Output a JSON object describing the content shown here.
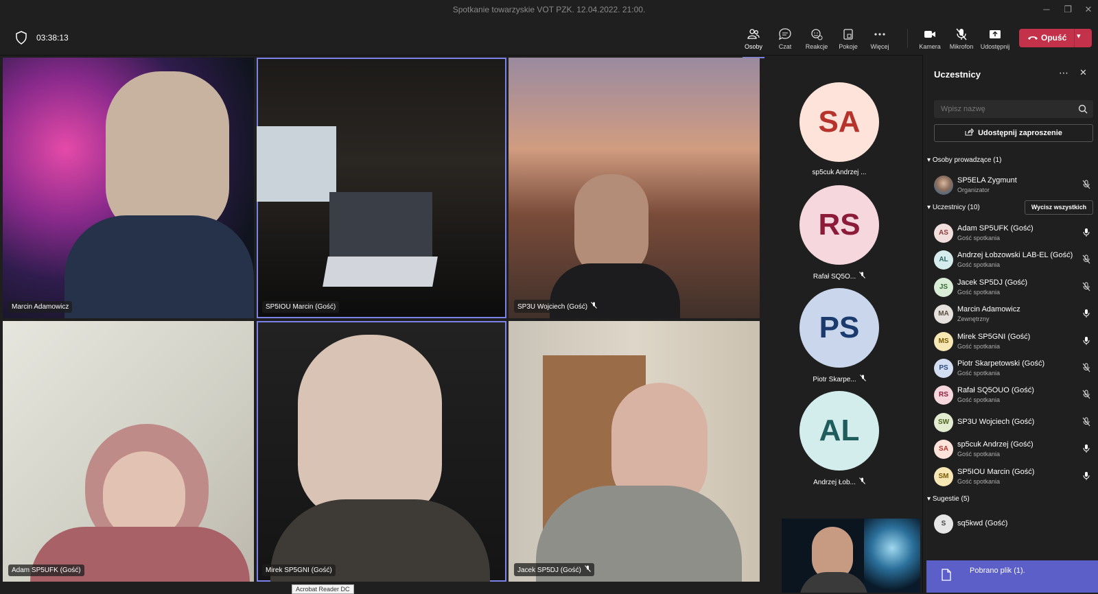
{
  "window": {
    "title": "Spotkanie towarzyskie VOT PZK. 12.04.2022. 21:00."
  },
  "toolbar": {
    "timer": "03:38:13",
    "people": "Osoby",
    "chat": "Czat",
    "reactions": "Reakcje",
    "rooms": "Pokoje",
    "more": "Więcej",
    "camera": "Kamera",
    "mic": "Mikrofon",
    "share": "Udostępnij",
    "leave": "Opuść"
  },
  "tiles": [
    {
      "name": "Marcin Adamowicz"
    },
    {
      "name": "SP5IOU Marcin (Gość)"
    },
    {
      "name": "SP3U Wojciech (Gość)"
    },
    {
      "name": "Adam SP5UFK (Gość)"
    },
    {
      "name": "Mirek SP5GNI (Gość)"
    },
    {
      "name": "Jacek SP5DJ (Gość)"
    }
  ],
  "avatars": [
    {
      "initials": "SA",
      "caption": "sp5cuk Andrzej ...",
      "bg": "#fde3d9",
      "fg": "#b5332a"
    },
    {
      "initials": "RS",
      "caption": "Rafał SQ5O...",
      "bg": "#f6d7dd",
      "fg": "#8c1b3a"
    },
    {
      "initials": "PS",
      "caption": "Piotr Skarpe...",
      "bg": "#c9d6ec",
      "fg": "#1b3b6f"
    },
    {
      "initials": "AL",
      "caption": "Andrzej Łob...",
      "bg": "#d3ecec",
      "fg": "#1f5c5c"
    }
  ],
  "panel": {
    "title": "Uczestnicy",
    "search_placeholder": "Wpisz nazwę",
    "invite": "Udostępnij zaproszenie",
    "presenters": "Osoby prowadzące (1)",
    "organizer": {
      "name": "SP5ELA Zygmunt",
      "role": "Organizator"
    },
    "attendees": "Uczestnicy (10)",
    "mute_all": "Wycisz wszystkich",
    "people": [
      {
        "initials": "AS",
        "name": "Adam SP5UFK (Gość)",
        "sub": "Gość spotkania",
        "bg": "#f3dede",
        "fg": "#8b3a3a",
        "muted": false
      },
      {
        "initials": "AL",
        "name": "Andrzej Łobzowski LAB-EL (Gość)",
        "sub": "Gość spotkania",
        "bg": "#d6ecec",
        "fg": "#2a6464",
        "muted": true
      },
      {
        "initials": "JS",
        "name": "Jacek SP5DJ (Gość)",
        "sub": "Gość spotkania",
        "bg": "#d9ecd6",
        "fg": "#356b33",
        "muted": true
      },
      {
        "initials": "MA",
        "name": "Marcin Adamowicz",
        "sub": "Zewnętrzny",
        "bg": "#e6e1dc",
        "fg": "#5a4d40",
        "muted": false
      },
      {
        "initials": "MS",
        "name": "Mirek SP5GNI (Gość)",
        "sub": "Gość spotkania",
        "bg": "#f6e7b5",
        "fg": "#7a5a00",
        "muted": false
      },
      {
        "initials": "PS",
        "name": "Piotr Skarpetowski (Gość)",
        "sub": "Gość spotkania",
        "bg": "#d3def2",
        "fg": "#2b4a7d",
        "muted": true
      },
      {
        "initials": "RS",
        "name": "Rafał SQ5OUO (Gość)",
        "sub": "Gość spotkania",
        "bg": "#f6d7dd",
        "fg": "#8c1b3a",
        "muted": true
      },
      {
        "initials": "SW",
        "name": "SP3U Wojciech (Gość)",
        "sub": "",
        "bg": "#e3ecd0",
        "fg": "#4e6320",
        "muted": true
      },
      {
        "initials": "SA",
        "name": "sp5cuk Andrzej (Gość)",
        "sub": "Gość spotkania",
        "bg": "#fde3d9",
        "fg": "#b5332a",
        "muted": false
      },
      {
        "initials": "SM",
        "name": "SP5IOU Marcin (Gość)",
        "sub": "Gość spotkania",
        "bg": "#f6e7b5",
        "fg": "#7a5a00",
        "muted": false
      }
    ],
    "suggestions": "Sugestie (5)",
    "suggested": [
      {
        "initials": "S",
        "name": "sq5kwd (Gość)"
      }
    ]
  },
  "toast": "Pobrano plik (1).",
  "tooltip": "Acrobat Reader DC",
  "colors": {
    "accent": "#7b83eb",
    "leave": "#c4314b",
    "toast": "#5b5fc7"
  }
}
